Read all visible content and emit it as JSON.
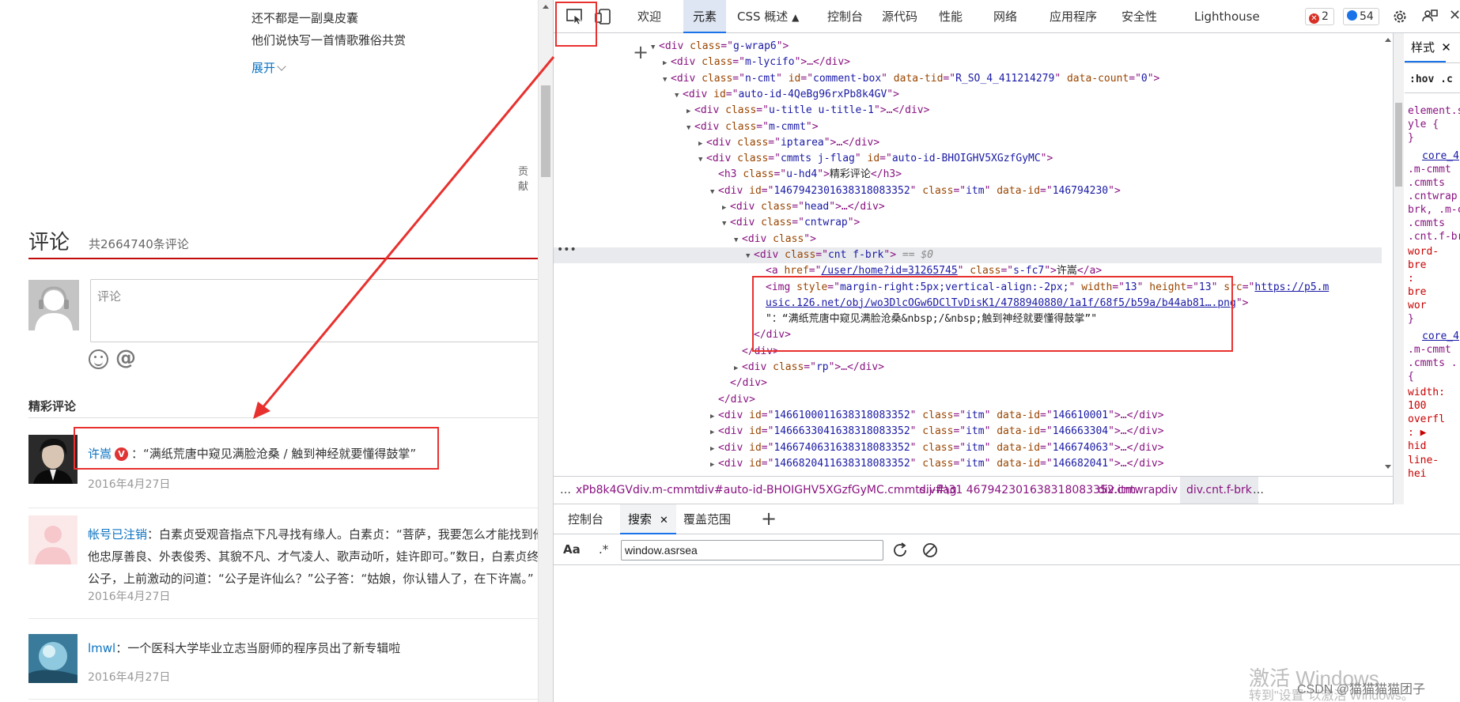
{
  "page": {
    "lyrics": [
      "还不都是一副臭皮囊",
      "他们说快写一首情歌雅俗共赏"
    ],
    "expand_label": "展开",
    "contrib_label": "贡献",
    "comments_title": "评论",
    "comments_count": "共2664740条评论",
    "comment_placeholder": "评论",
    "hot_title": "精彩评论",
    "comments": [
      {
        "user": "许嵩",
        "verified": "V",
        "text": "：“满纸荒唐中窥见满脸沧桑 / 触到神经就要懂得鼓掌”",
        "time": "2016年4月27日"
      },
      {
        "user": "帐号已注销",
        "text": "：白素贞受观音指点下凡寻找有缘人。白素贞：“菩萨，我要怎么才能找到他",
        "text2": "他忠厚善良、外表俊秀、其貌不凡、才气凌人、歌声动听，娃许即可。”数日，白素贞终",
        "text3": "公子，上前激动的问道：“公子是许仙么？”公子答：“姑娘，你认错人了，在下许嵩。”",
        "time": "2016年4月27日"
      },
      {
        "user": "lmwl",
        "text": "：一个医科大学毕业立志当厨师的程序员出了新专辑啦",
        "time": "2016年4月27日"
      }
    ]
  },
  "devtools": {
    "tabs": [
      "欢迎",
      "元素",
      "CSS 概述",
      "控制台",
      "源代码",
      "性能",
      "网络",
      "应用程序",
      "安全性",
      "Lighthouse"
    ],
    "active_tab": "元素",
    "error_count": "2",
    "message_count": "54",
    "dom_lines": [
      {
        "indent": 9,
        "tri": "▼",
        "parts": [
          [
            "tg",
            "<div "
          ],
          [
            "an",
            "class"
          ],
          [
            "tg",
            "=\""
          ],
          [
            "av2",
            "g-wrap6"
          ],
          [
            "tg",
            "\">"
          ]
        ]
      },
      {
        "indent": 10,
        "tri": "▶",
        "parts": [
          [
            "tg",
            "<div "
          ],
          [
            "an",
            "class"
          ],
          [
            "tg",
            "=\""
          ],
          [
            "av2",
            "m-lycifo"
          ],
          [
            "tg",
            "\">…</div>"
          ]
        ]
      },
      {
        "indent": 10,
        "tri": "▼",
        "parts": [
          [
            "tg",
            "<div "
          ],
          [
            "an",
            "class"
          ],
          [
            "tg",
            "=\""
          ],
          [
            "av2",
            "n-cmt"
          ],
          [
            "tg",
            "\" "
          ],
          [
            "an",
            "id"
          ],
          [
            "tg",
            "=\""
          ],
          [
            "av2",
            "comment-box"
          ],
          [
            "tg",
            "\" "
          ],
          [
            "an",
            "data-tid"
          ],
          [
            "tg",
            "=\""
          ],
          [
            "av2",
            "R_SO_4_411214279"
          ],
          [
            "tg",
            "\" "
          ],
          [
            "an",
            "data-count"
          ],
          [
            "tg",
            "=\""
          ],
          [
            "av2",
            "0"
          ],
          [
            "tg",
            "\">"
          ]
        ]
      },
      {
        "indent": 11,
        "tri": "▼",
        "parts": [
          [
            "tg",
            "<div "
          ],
          [
            "an",
            "id"
          ],
          [
            "tg",
            "=\""
          ],
          [
            "av2",
            "auto-id-4QeBg96rxPb8k4GV"
          ],
          [
            "tg",
            "\">"
          ]
        ]
      },
      {
        "indent": 12,
        "tri": "▶",
        "parts": [
          [
            "tg",
            "<div "
          ],
          [
            "an",
            "class"
          ],
          [
            "tg",
            "=\""
          ],
          [
            "av2",
            "u-title u-title-1"
          ],
          [
            "tg",
            "\">…</div>"
          ]
        ]
      },
      {
        "indent": 12,
        "tri": "▼",
        "parts": [
          [
            "tg",
            "<div "
          ],
          [
            "an",
            "class"
          ],
          [
            "tg",
            "=\""
          ],
          [
            "av2",
            "m-cmmt"
          ],
          [
            "tg",
            "\">"
          ]
        ]
      },
      {
        "indent": 13,
        "tri": "▶",
        "parts": [
          [
            "tg",
            "<div "
          ],
          [
            "an",
            "class"
          ],
          [
            "tg",
            "=\""
          ],
          [
            "av2",
            "iptarea"
          ],
          [
            "tg",
            "\">…</div>"
          ]
        ]
      },
      {
        "indent": 13,
        "tri": "▼",
        "parts": [
          [
            "tg",
            "<div "
          ],
          [
            "an",
            "class"
          ],
          [
            "tg",
            "=\""
          ],
          [
            "av2",
            "cmmts j-flag"
          ],
          [
            "tg",
            "\" "
          ],
          [
            "an",
            "id"
          ],
          [
            "tg",
            "=\""
          ],
          [
            "av2",
            "auto-id-BHOIGHV5XGzfGyMC"
          ],
          [
            "tg",
            "\">"
          ]
        ]
      },
      {
        "indent": 14,
        "tri": "",
        "parts": [
          [
            "tg",
            "<h3 "
          ],
          [
            "an",
            "class"
          ],
          [
            "tg",
            "=\""
          ],
          [
            "av2",
            "u-hd4"
          ],
          [
            "tg",
            "\">"
          ],
          [
            "tx",
            "精彩评论"
          ],
          [
            "tg",
            "</h3>"
          ]
        ]
      },
      {
        "indent": 14,
        "tri": "▼",
        "parts": [
          [
            "tg",
            "<div "
          ],
          [
            "an",
            "id"
          ],
          [
            "tg",
            "=\""
          ],
          [
            "av2",
            "1467942301638318083352"
          ],
          [
            "tg",
            "\" "
          ],
          [
            "an",
            "class"
          ],
          [
            "tg",
            "=\""
          ],
          [
            "av2",
            "itm"
          ],
          [
            "tg",
            "\" "
          ],
          [
            "an",
            "data-id"
          ],
          [
            "tg",
            "=\""
          ],
          [
            "av2",
            "146794230"
          ],
          [
            "tg",
            "\">"
          ]
        ]
      },
      {
        "indent": 15,
        "tri": "▶",
        "parts": [
          [
            "tg",
            "<div "
          ],
          [
            "an",
            "class"
          ],
          [
            "tg",
            "=\""
          ],
          [
            "av2",
            "head"
          ],
          [
            "tg",
            "\">…</div>"
          ]
        ]
      },
      {
        "indent": 15,
        "tri": "▼",
        "parts": [
          [
            "tg",
            "<div "
          ],
          [
            "an",
            "class"
          ],
          [
            "tg",
            "=\""
          ],
          [
            "av2",
            "cntwrap"
          ],
          [
            "tg",
            "\">"
          ]
        ]
      },
      {
        "indent": 16,
        "tri": "▼",
        "parts": [
          [
            "tg",
            "<div "
          ],
          [
            "an",
            "class"
          ],
          [
            "tg",
            "\">"
          ]
        ]
      },
      {
        "indent": 17,
        "tri": "▼",
        "sel": true,
        "parts": [
          [
            "tg",
            "<div "
          ],
          [
            "an",
            "class"
          ],
          [
            "tg",
            "=\""
          ],
          [
            "av2",
            "cnt f-brk"
          ],
          [
            "tg",
            "\">"
          ],
          [
            "cm",
            " == $0"
          ]
        ]
      },
      {
        "indent": 18,
        "tri": "",
        "parts": [
          [
            "tg",
            "<a "
          ],
          [
            "an",
            "href"
          ],
          [
            "tg",
            "=\""
          ],
          [
            "lk",
            "/user/home?id=31265745"
          ],
          [
            "tg",
            "\" "
          ],
          [
            "an",
            "class"
          ],
          [
            "tg",
            "=\""
          ],
          [
            "av2",
            "s-fc7"
          ],
          [
            "tg",
            "\">"
          ],
          [
            "tx",
            "许嵩"
          ],
          [
            "tg",
            "</a>"
          ]
        ]
      },
      {
        "indent": 18,
        "tri": "",
        "parts": [
          [
            "tg",
            "<img "
          ],
          [
            "an",
            "style"
          ],
          [
            "tg",
            "=\""
          ],
          [
            "av2",
            "margin-right:5px;vertical-align:-2px;"
          ],
          [
            "tg",
            "\" "
          ],
          [
            "an",
            "width"
          ],
          [
            "tg",
            "=\""
          ],
          [
            "av2",
            "13"
          ],
          [
            "tg",
            "\" "
          ],
          [
            "an",
            "height"
          ],
          [
            "tg",
            "=\""
          ],
          [
            "av2",
            "13"
          ],
          [
            "tg",
            "\" "
          ],
          [
            "an",
            "src"
          ],
          [
            "tg",
            "=\""
          ],
          [
            "lk",
            "https://p5.m"
          ]
        ]
      },
      {
        "indent": 18,
        "tri": "",
        "parts": [
          [
            "lk",
            "usic.126.net/obj/wo3DlcOGw6DClTvDisK1/4788940880/1a1f/68f5/b59a/b44ab81….png"
          ],
          [
            "tg",
            "\">"
          ]
        ]
      },
      {
        "indent": 18,
        "tri": "",
        "parts": [
          [
            "tx",
            "\"：“满纸荒唐中窥见满脸沧桑&nbsp;/&nbsp;触到神经就要懂得鼓掌”\""
          ]
        ]
      },
      {
        "indent": 17,
        "tri": "",
        "parts": [
          [
            "tg",
            "</div>"
          ]
        ]
      },
      {
        "indent": 16,
        "tri": "",
        "parts": [
          [
            "tg",
            "</div>"
          ]
        ]
      },
      {
        "indent": 16,
        "tri": "▶",
        "parts": [
          [
            "tg",
            "<div "
          ],
          [
            "an",
            "class"
          ],
          [
            "tg",
            "=\""
          ],
          [
            "av2",
            "rp"
          ],
          [
            "tg",
            "\">…</div>"
          ]
        ]
      },
      {
        "indent": 15,
        "tri": "",
        "parts": [
          [
            "tg",
            "</div>"
          ]
        ]
      },
      {
        "indent": 14,
        "tri": "",
        "parts": [
          [
            "tg",
            "</div>"
          ]
        ]
      },
      {
        "indent": 14,
        "tri": "▶",
        "parts": [
          [
            "tg",
            "<div "
          ],
          [
            "an",
            "id"
          ],
          [
            "tg",
            "=\""
          ],
          [
            "av2",
            "1466100011638318083352"
          ],
          [
            "tg",
            "\" "
          ],
          [
            "an",
            "class"
          ],
          [
            "tg",
            "=\""
          ],
          [
            "av2",
            "itm"
          ],
          [
            "tg",
            "\" "
          ],
          [
            "an",
            "data-id"
          ],
          [
            "tg",
            "=\""
          ],
          [
            "av2",
            "146610001"
          ],
          [
            "tg",
            "\">…</div>"
          ]
        ]
      },
      {
        "indent": 14,
        "tri": "▶",
        "parts": [
          [
            "tg",
            "<div "
          ],
          [
            "an",
            "id"
          ],
          [
            "tg",
            "=\""
          ],
          [
            "av2",
            "1466633041638318083352"
          ],
          [
            "tg",
            "\" "
          ],
          [
            "an",
            "class"
          ],
          [
            "tg",
            "=\""
          ],
          [
            "av2",
            "itm"
          ],
          [
            "tg",
            "\" "
          ],
          [
            "an",
            "data-id"
          ],
          [
            "tg",
            "=\""
          ],
          [
            "av2",
            "146663304"
          ],
          [
            "tg",
            "\">…</div>"
          ]
        ]
      },
      {
        "indent": 14,
        "tri": "▶",
        "parts": [
          [
            "tg",
            "<div "
          ],
          [
            "an",
            "id"
          ],
          [
            "tg",
            "=\""
          ],
          [
            "av2",
            "1466740631638318083352"
          ],
          [
            "tg",
            "\" "
          ],
          [
            "an",
            "class"
          ],
          [
            "tg",
            "=\""
          ],
          [
            "av2",
            "itm"
          ],
          [
            "tg",
            "\" "
          ],
          [
            "an",
            "data-id"
          ],
          [
            "tg",
            "=\""
          ],
          [
            "av2",
            "146674063"
          ],
          [
            "tg",
            "\">…</div>"
          ]
        ]
      },
      {
        "indent": 14,
        "tri": "▶",
        "parts": [
          [
            "tg",
            "<div "
          ],
          [
            "an",
            "id"
          ],
          [
            "tg",
            "=\""
          ],
          [
            "av2",
            "1466820411638318083352"
          ],
          [
            "tg",
            "\" "
          ],
          [
            "an",
            "class"
          ],
          [
            "tg",
            "=\""
          ],
          [
            "av2",
            "itm"
          ],
          [
            "tg",
            "\" "
          ],
          [
            "an",
            "data-id"
          ],
          [
            "tg",
            "=\""
          ],
          [
            "av2",
            "146682041"
          ],
          [
            "tg",
            "\">…</div>"
          ]
        ]
      }
    ],
    "breadcrumbs": [
      "…",
      "xPb8k4GV",
      "div.m-cmmt",
      "div#auto-id-BHOIGHV5XGzfGyMC.cmmts.j-flag",
      "div#\\31 467942301638318083352.itm",
      "div.cntwrap",
      "div",
      "div.cnt.f-brk",
      "…"
    ],
    "drawer_tabs": [
      "控制台",
      "搜索",
      "覆盖范围"
    ],
    "drawer_active": "搜索",
    "search_aa": "Aa",
    "search_regex": ".*",
    "search_value": "window.asrsea",
    "styles": {
      "tab": "样式",
      "hov": ":hov .c",
      "lines": [
        [
          "st-sel",
          "element.s"
        ],
        [
          "st-sel",
          "yle {"
        ],
        [
          "st-sel",
          "}"
        ],
        [
          "st-link",
          "core_4"
        ],
        [
          "st-sel",
          ".m-cmmt"
        ],
        [
          "st-sel",
          ".cmmts"
        ],
        [
          "st-sel",
          ".cntwrap"
        ],
        [
          "st-sel",
          "brk, .m-c"
        ],
        [
          "st-sel",
          ".cmmts"
        ],
        [
          "st-sel",
          ".cnt.f-br"
        ],
        [
          "st-prop",
          "word-"
        ],
        [
          "st-prop",
          "  bre"
        ],
        [
          "st-prop",
          "  :"
        ],
        [
          "st-prop",
          "  bre"
        ],
        [
          "st-prop",
          "  wor"
        ],
        [
          "st-sel",
          "}"
        ],
        [
          "st-link",
          "core_4"
        ],
        [
          "st-sel",
          ".m-cmmt"
        ],
        [
          "st-sel",
          ".cmmts ."
        ],
        [
          "st-sel",
          "{"
        ],
        [
          "st-prop",
          "width:"
        ],
        [
          "st-prop",
          "  100"
        ],
        [
          "st-prop",
          "overfl"
        ],
        [
          "st-prop",
          "  : ▶"
        ],
        [
          "st-prop",
          "  hid"
        ],
        [
          "st-prop",
          "line-"
        ],
        [
          "st-prop",
          "  hei"
        ]
      ]
    }
  },
  "watermark": "激活 Windows",
  "watermark2": "转到\"设置\"以激活 Windows。",
  "csdn": "CSDN @猫猫猫猫团子"
}
